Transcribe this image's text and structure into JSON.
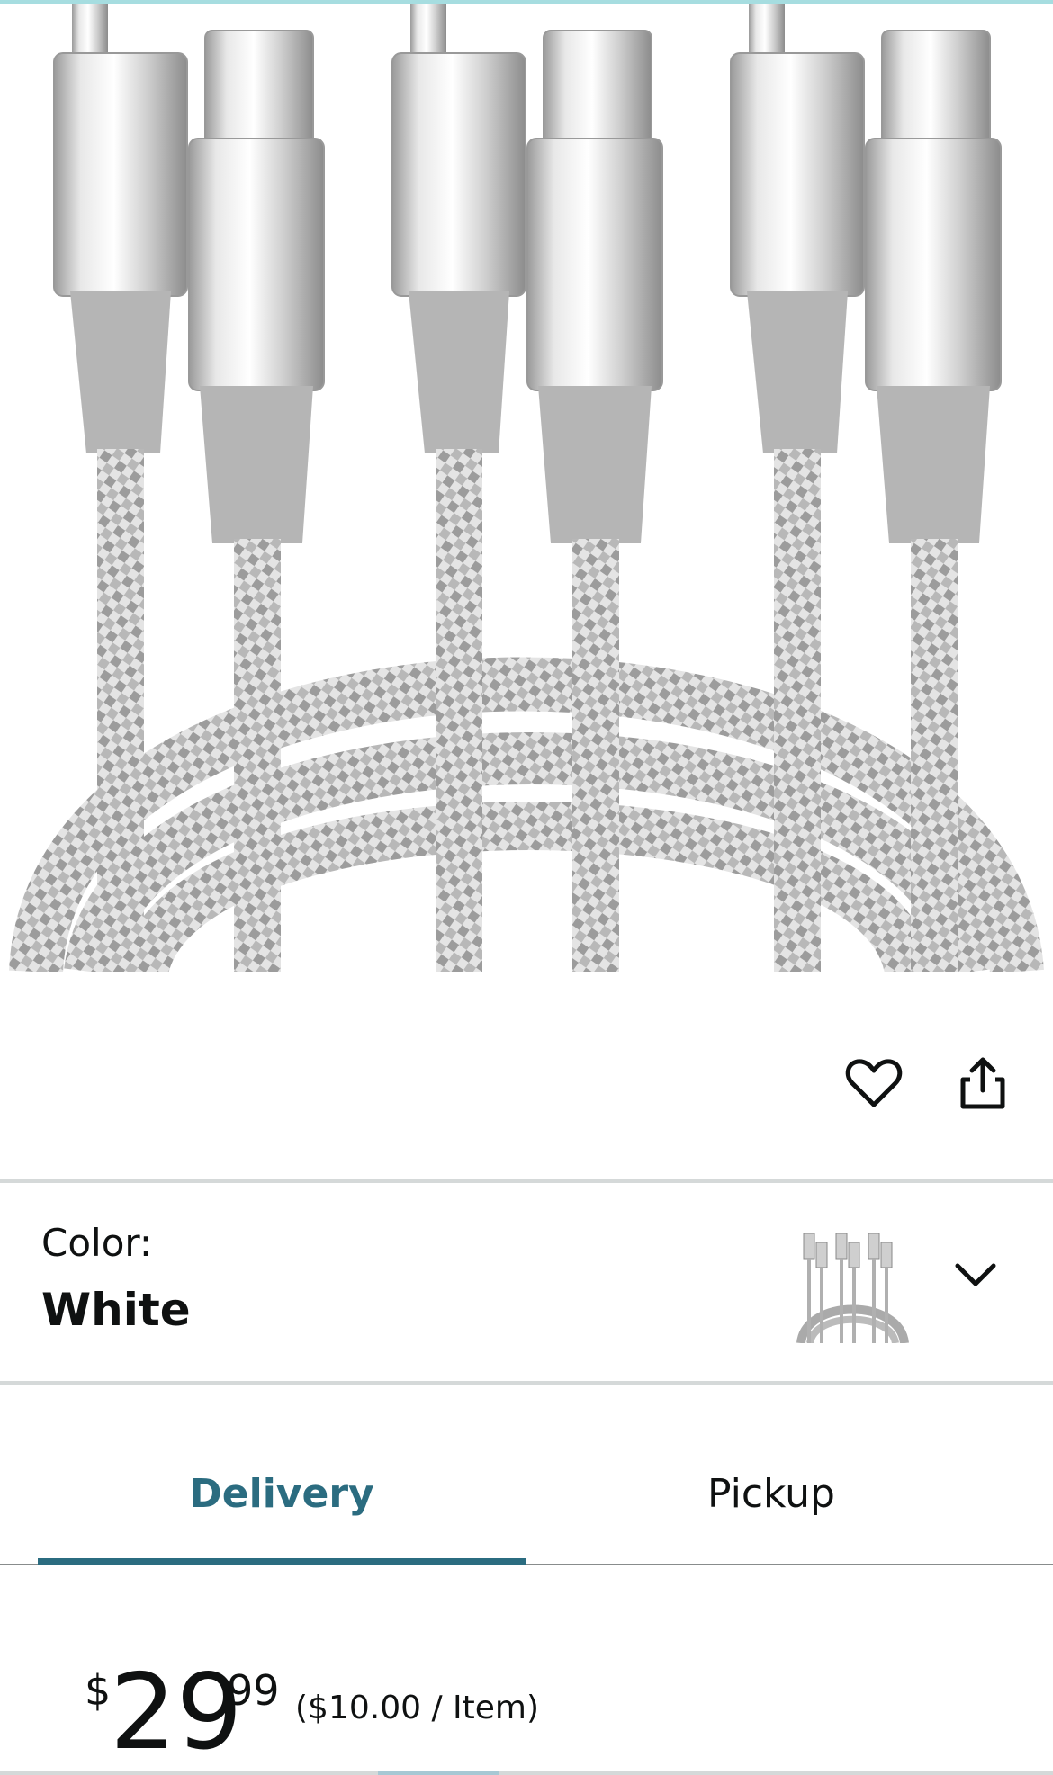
{
  "product": {
    "image_alt": "cables-product-image"
  },
  "actions": {
    "wishlist_icon": "heart-icon",
    "share_icon": "share-icon"
  },
  "color_selector": {
    "label": "Color:",
    "value": "White",
    "thumbnail": "cables-thumbnail",
    "chevron_icon": "chevron-down-icon"
  },
  "tabs": [
    {
      "label": "Delivery",
      "active": true
    },
    {
      "label": "Pickup",
      "active": false
    }
  ],
  "price": {
    "symbol": "$",
    "whole": "29",
    "fraction": "99",
    "unit_price": "($10.00 / Item)"
  },
  "colors": {
    "accent_teal": "#2b6c80",
    "divider": "#d5d9d9",
    "text": "#0f1111"
  }
}
